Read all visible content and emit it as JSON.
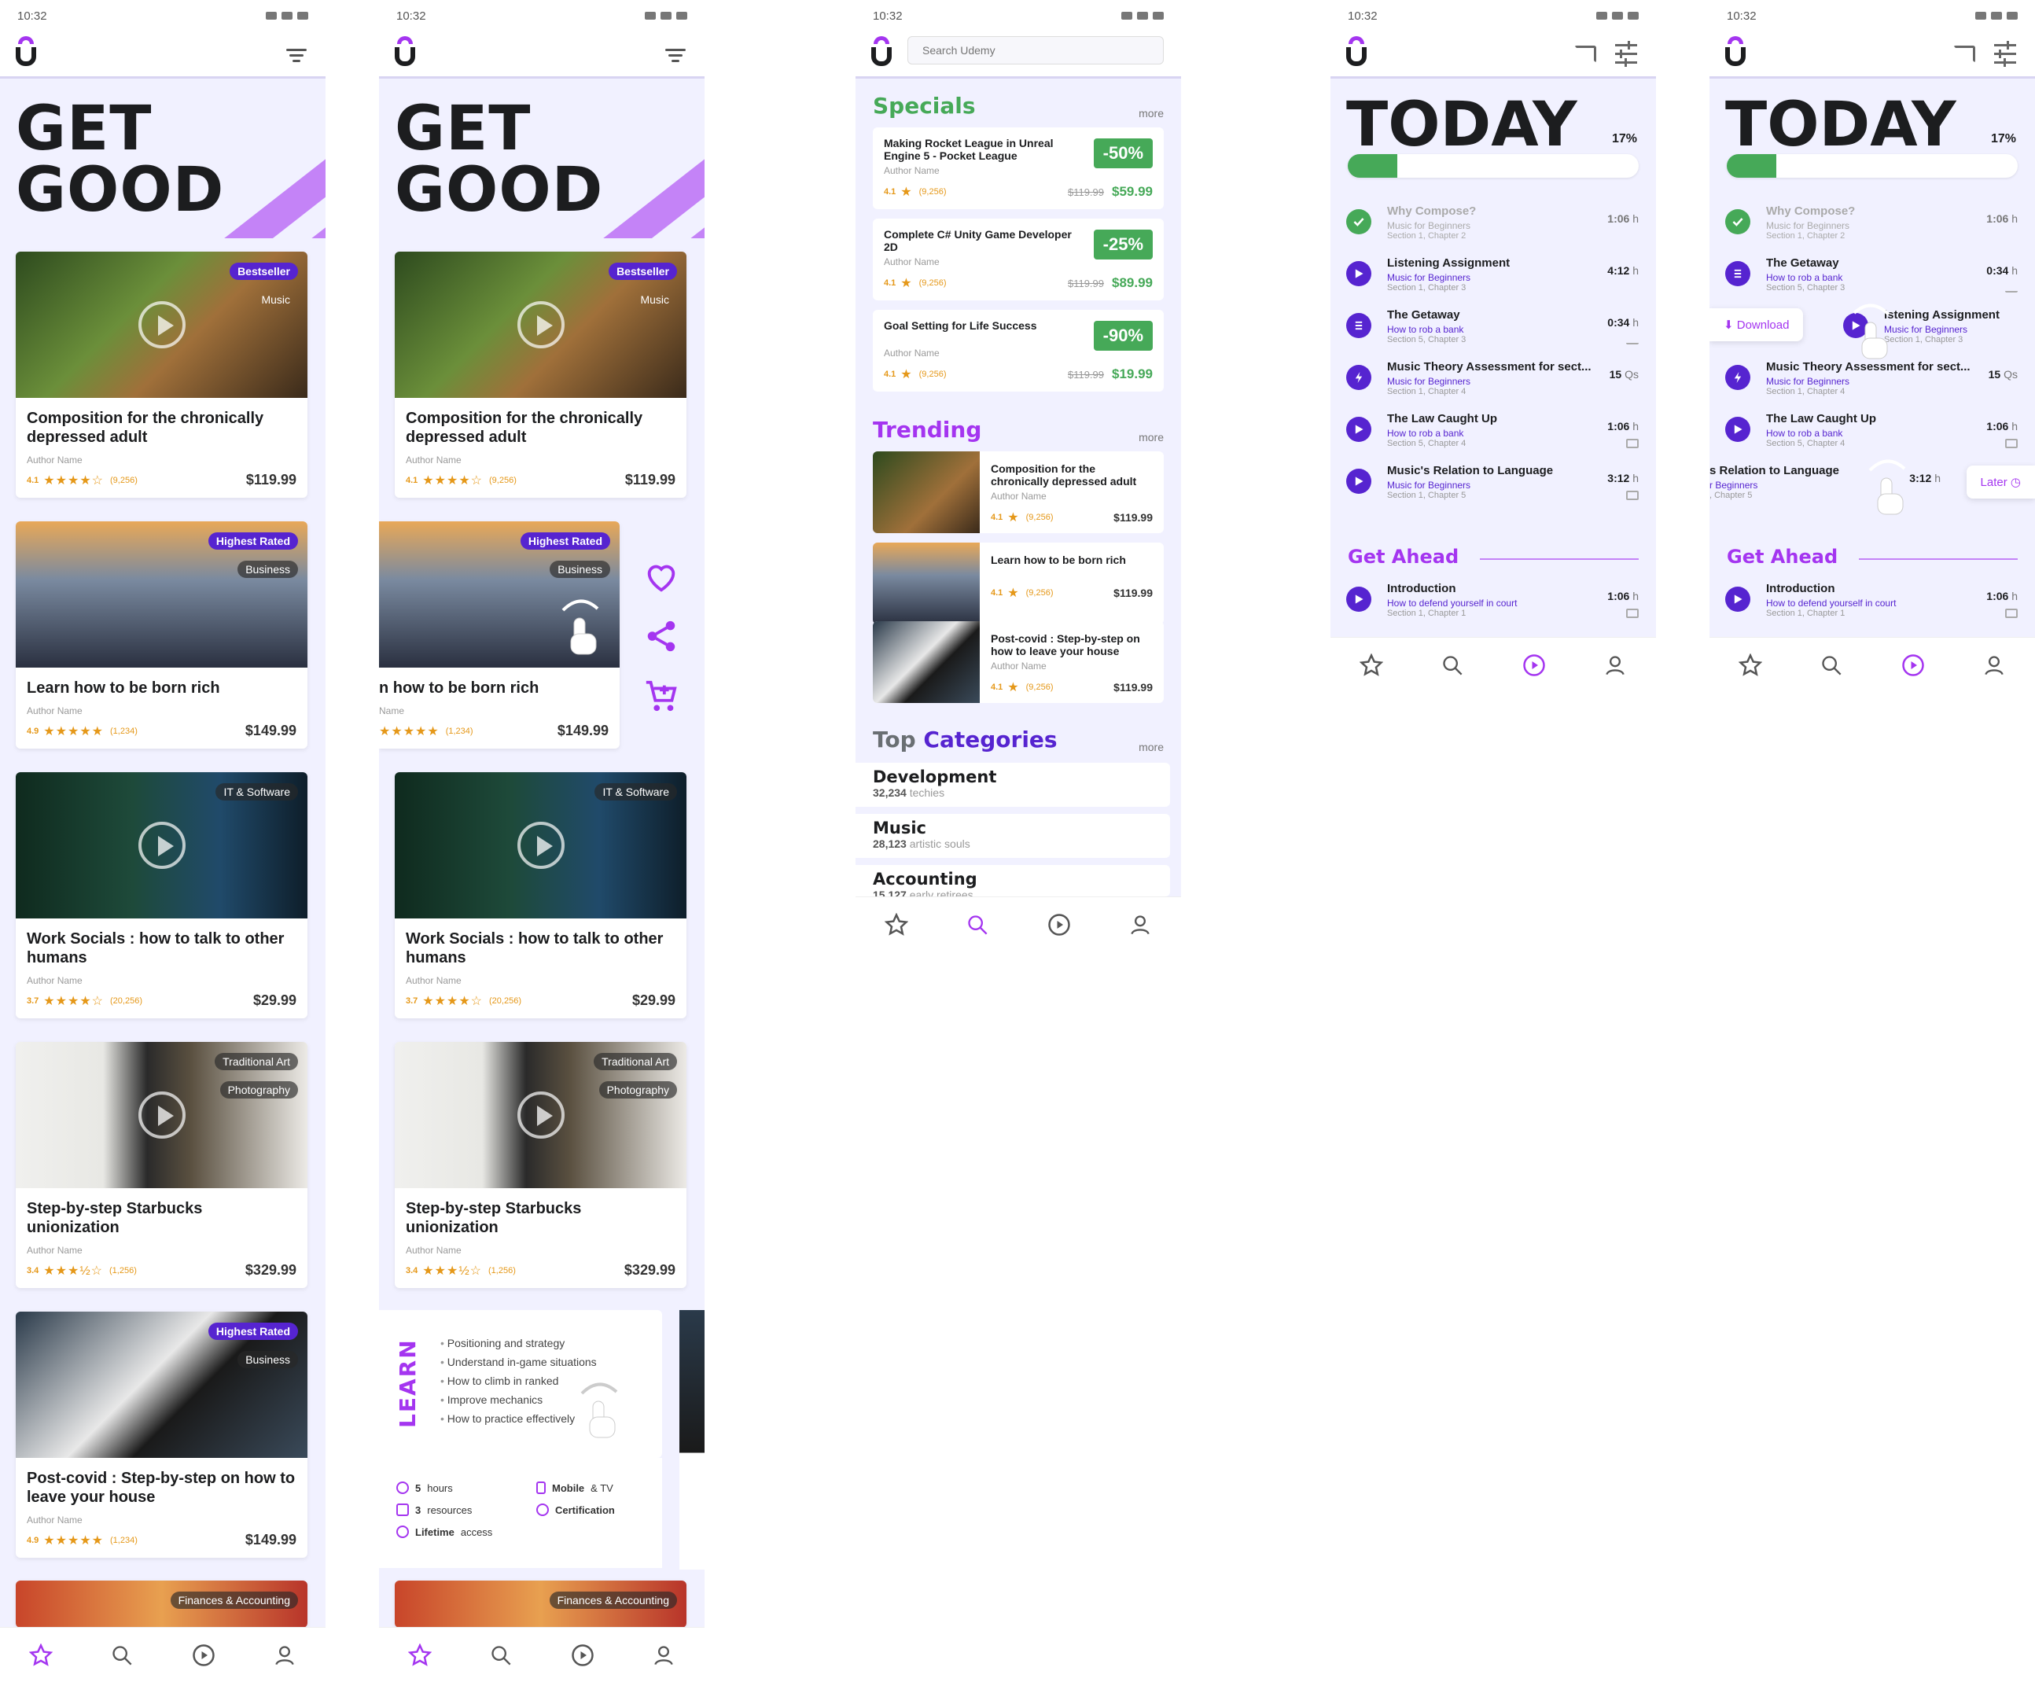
{
  "status_time": "10:32",
  "colors": {
    "accent": "#a435f0",
    "deep_purple": "#5624d0",
    "green": "#46a958",
    "bg": "#f1f1ff",
    "star": "#e59819"
  },
  "home": {
    "hero_line1": "GET",
    "hero_line2": "GOOD",
    "cards": [
      {
        "title": "Composition for the chronically depressed adult",
        "author": "Author Name",
        "rating": "4.1",
        "stars": "★★★★☆",
        "count": "(9,256)",
        "price": "$119.99",
        "tag1": "Bestseller",
        "tag2": "Music"
      },
      {
        "title": "Learn how to be born rich",
        "author": "Author Name",
        "rating": "4.9",
        "stars": "★★★★★",
        "count": "(1,234)",
        "price": "$149.99",
        "tag1": "Highest Rated",
        "tag2": "Business"
      },
      {
        "title": "Work Socials : how to talk to other humans",
        "author": "Author Name",
        "rating": "3.7",
        "stars": "★★★★☆",
        "count": "(20,256)",
        "price": "$29.99",
        "tag1": "IT & Software"
      },
      {
        "title": "Step-by-step Starbucks unionization",
        "author": "Author Name",
        "rating": "3.4",
        "stars": "★★★½☆",
        "count": "(1,256)",
        "price": "$329.99",
        "tag1": "Traditional Art",
        "tag2": "Photography"
      },
      {
        "title": "Post-covid : Step-by-step on how to leave your house",
        "author": "Author Name",
        "rating": "4.9",
        "stars": "★★★★★",
        "count": "(1,234)",
        "price": "$149.99",
        "tag1": "Highest Rated",
        "tag2": "Business"
      },
      {
        "tag1": "Finances & Accounting"
      }
    ],
    "card2_clipped_title": "n how to be born rich",
    "card2_clipped_author": "Name",
    "learn": {
      "word": "LEARN",
      "items": [
        "Positioning and strategy",
        "Understand in-game situations",
        "How to climb in ranked",
        "Improve mechanics",
        "How to practice effectively"
      ],
      "hours_num": "5",
      "hours_txt": "hours",
      "res_num": "3",
      "res_txt": "resources",
      "lifetime_b": "Lifetime",
      "lifetime_txt": "access",
      "mobile_b": "Mobile",
      "mobile_txt": "& TV",
      "cert": "Certification"
    }
  },
  "search": {
    "placeholder": "Search Udemy",
    "specials_title": "Specials",
    "more": "more",
    "specials": [
      {
        "title": "Making Rocket League in Unreal Engine 5 - Pocket League",
        "author": "Author Name",
        "rating": "4.1",
        "count": "(9,256)",
        "discount": "-50%",
        "old": "$119.99",
        "new": "$59.99"
      },
      {
        "title": "Complete C# Unity Game Developer 2D",
        "author": "Author Name",
        "rating": "4.1",
        "count": "(9,256)",
        "discount": "-25%",
        "old": "$119.99",
        "new": "$89.99"
      },
      {
        "title": "Goal Setting for Life Success",
        "author": "Author Name",
        "rating": "4.1",
        "count": "(9,256)",
        "discount": "-90%",
        "old": "$119.99",
        "new": "$19.99"
      }
    ],
    "trending_title": "Trending",
    "trending": [
      {
        "title": "Composition for the chronically depressed adult",
        "author": "Author Name",
        "rating": "4.1",
        "count": "(9,256)",
        "price": "$119.99"
      },
      {
        "title": "Learn how to be born rich",
        "author": "",
        "rating": "4.1",
        "count": "(9,256)",
        "price": "$119.99"
      },
      {
        "title": "Post-covid : Step-by-step on how to leave your house",
        "author": "Author Name",
        "rating": "4.1",
        "count": "(9,256)",
        "price": "$119.99"
      }
    ],
    "top_title_a": "Top",
    "top_title_b": "Categories",
    "categories": [
      {
        "name": "Development",
        "count": "32,234",
        "label": "techies"
      },
      {
        "name": "Music",
        "count": "28,123",
        "label": "artistic souls"
      },
      {
        "name": "Accounting",
        "count": "15,127",
        "label": "early retirees"
      }
    ]
  },
  "learning": {
    "title": "TODAY",
    "percent": "17%",
    "progress": 0.17,
    "lessons": [
      {
        "title": "Why Compose?",
        "course": "Music for Beginners",
        "section": "Section 1, Chapter 2",
        "dur": "1:06",
        "unit": "h",
        "icon": "check"
      },
      {
        "title": "Listening Assignment",
        "course": "Music for Beginners",
        "section": "Section 1, Chapter 3",
        "dur": "4:12",
        "unit": "h",
        "icon": "play"
      },
      {
        "title": "The Getaway",
        "course": "How to rob a bank",
        "section": "Section 5, Chapter 3",
        "dur": "0:34",
        "unit": "h",
        "icon": "doc"
      },
      {
        "title": "Music Theory Assessment for sect...",
        "course": "Music for Beginners",
        "section": "Section 1, Chapter 4",
        "dur": "15",
        "unit": "Qs",
        "icon": "bolt"
      },
      {
        "title": "The Law Caught Up",
        "course": "How to rob a bank",
        "section": "Section 5, Chapter 4",
        "dur": "1:06",
        "unit": "h",
        "icon": "play"
      },
      {
        "title": "Music's Relation to Language",
        "course": "Music for Beginners",
        "section": "Section 1, Chapter 5",
        "dur": "3:12",
        "unit": "h",
        "icon": "play"
      }
    ],
    "get_ahead": "Get Ahead",
    "ahead": {
      "title": "Introduction",
      "course": "How to defend yourself in court",
      "section": "Section 1, Chapter 1",
      "dur": "1:06",
      "unit": "h"
    },
    "download": "Download",
    "later": "Later",
    "s5_clip_title": "s Relation to Language",
    "s5_clip_course": "r Beginners",
    "s5_clip_section": ", Chapter 5",
    "s5_listen_title": "istening Assignment",
    "s5_listen_section": "Section 1, Chapter 3"
  }
}
